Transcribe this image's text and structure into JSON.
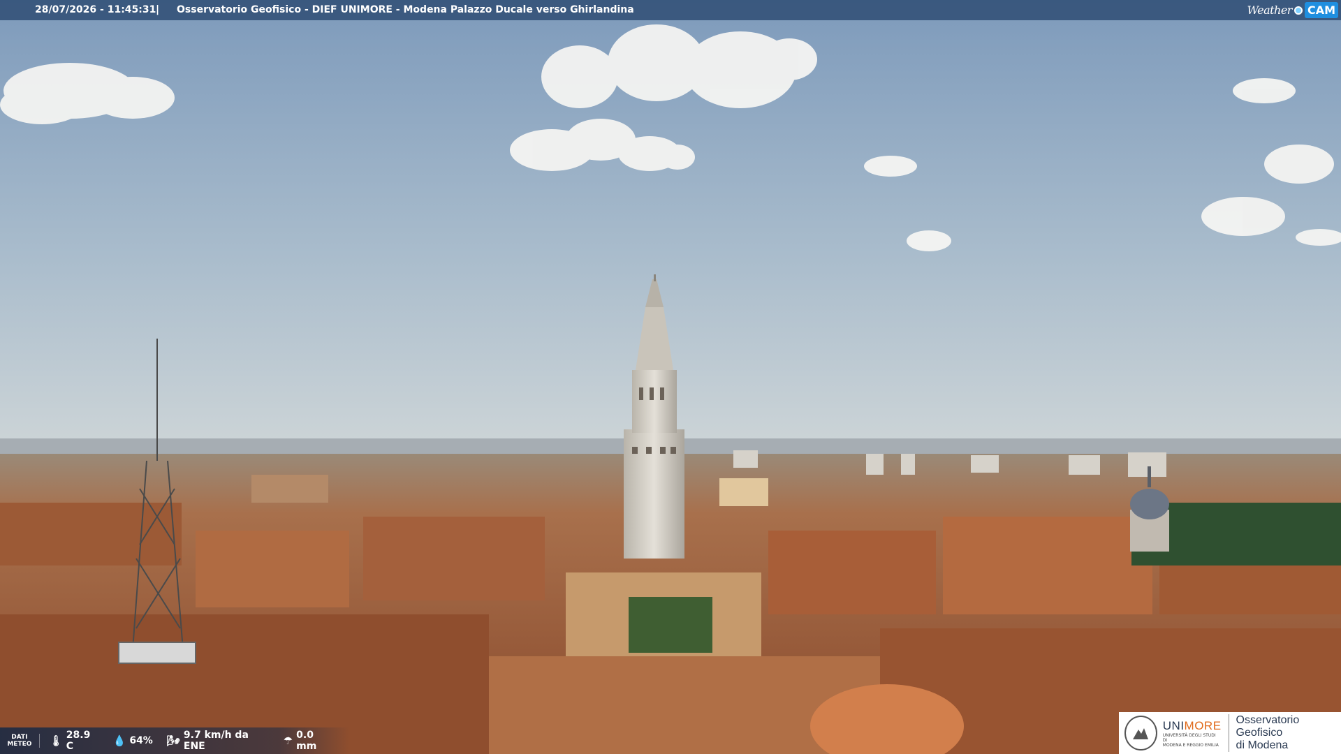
{
  "overlay": {
    "timestamp": "28/07/2026 - 11:45:31",
    "separator": "|",
    "title": "Osservatorio Geofisico - DIEF UNIMORE - Modena Palazzo Ducale verso Ghirlandina",
    "brand_weather": "Weather",
    "brand_cam": "CAM"
  },
  "meteo": {
    "label_line1": "DATI",
    "label_line2": "METEO",
    "temperature": "28.9 C",
    "humidity": "64%",
    "wind": "9.7 km/h da ENE",
    "rain": "0.0 mm",
    "icons": [
      "thermometer-icon",
      "humidity-drop-icon",
      "wind-icon",
      "rain-icon"
    ]
  },
  "logo": {
    "uni_prefix": "UNI",
    "uni_suffix": "MORE",
    "uni_sub_line1": "UNIVERSITÀ DEGLI STUDI DI",
    "uni_sub_line2": "MODENA E REGGIO EMILIA",
    "org_line1": "Osservatorio Geofisico",
    "org_line2": "di Modena"
  },
  "colors": {
    "sky_top": "#7f9cbc",
    "sky_bottom": "#c9d2d8",
    "roof": "#b0623a",
    "tower": "#d8d4cc",
    "accent_orange": "#e06a1b"
  }
}
